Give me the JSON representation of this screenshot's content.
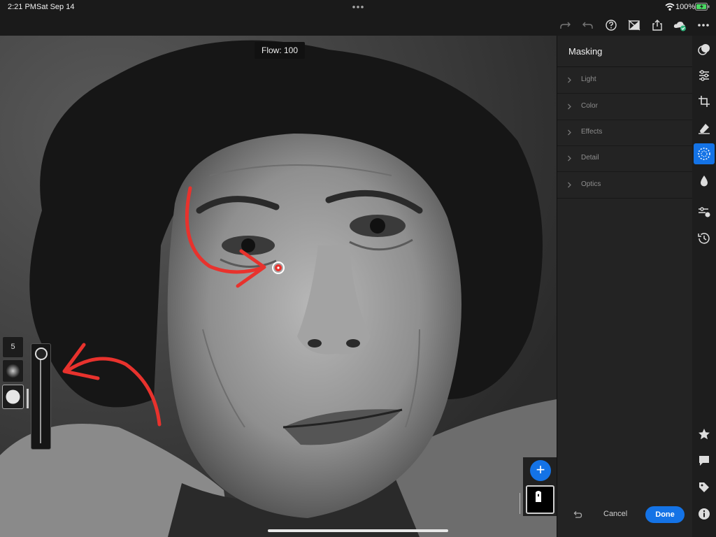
{
  "status_bar": {
    "time": "2:21 PM",
    "date": "Sat Sep 14",
    "battery_percent": "100%"
  },
  "toolbar": {
    "icons": [
      "redo-icon",
      "undo-icon",
      "help-icon",
      "compare-icon",
      "share-icon",
      "cloud-sync-icon",
      "more-icon"
    ]
  },
  "canvas": {
    "flow_label": "Flow: 100",
    "brush_size": "5",
    "flow_value": 100
  },
  "panel": {
    "title": "Masking",
    "sections": [
      {
        "label": "Light"
      },
      {
        "label": "Color"
      },
      {
        "label": "Effects"
      },
      {
        "label": "Detail"
      },
      {
        "label": "Optics"
      }
    ],
    "cancel_label": "Cancel",
    "done_label": "Done"
  },
  "rail": {
    "tools": [
      "presets-icon",
      "edit-adjust-icon",
      "crop-icon",
      "healing-icon",
      "masking-icon",
      "selective-icon",
      "versions-icon",
      "history-icon"
    ],
    "bottom_tools": [
      "rating-star-icon",
      "comment-icon",
      "tag-icon",
      "info-icon"
    ],
    "active_tool": "masking-icon"
  },
  "colors": {
    "accent": "#1473e6",
    "annotation_red": "#e8322d"
  }
}
